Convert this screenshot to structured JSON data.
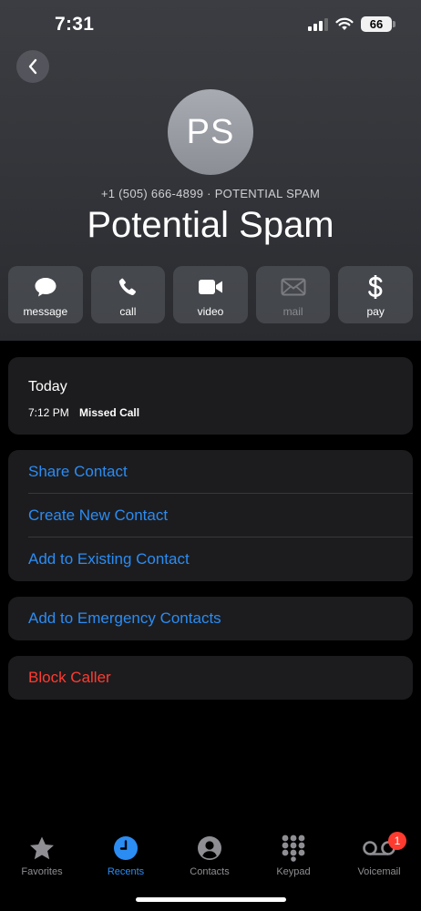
{
  "status_bar": {
    "time": "7:31",
    "battery": "66"
  },
  "contact": {
    "initials": "PS",
    "subtitle": "+1 (505) 666-4899 · POTENTIAL SPAM",
    "name": "Potential Spam"
  },
  "actions": [
    {
      "label": "message",
      "icon": "message-icon",
      "enabled": true
    },
    {
      "label": "call",
      "icon": "phone-icon",
      "enabled": true
    },
    {
      "label": "video",
      "icon": "video-icon",
      "enabled": true
    },
    {
      "label": "mail",
      "icon": "mail-icon",
      "enabled": false
    },
    {
      "label": "pay",
      "icon": "dollar-icon",
      "enabled": true
    }
  ],
  "history": {
    "title": "Today",
    "time": "7:12 PM",
    "kind": "Missed Call"
  },
  "contact_options": {
    "share": "Share Contact",
    "create": "Create New Contact",
    "add_existing": "Add to Existing Contact"
  },
  "emergency": "Add to Emergency Contacts",
  "block": "Block Caller",
  "tabs": [
    {
      "label": "Favorites",
      "icon": "star-icon",
      "active": false
    },
    {
      "label": "Recents",
      "icon": "clock-icon",
      "active": true
    },
    {
      "label": "Contacts",
      "icon": "person-icon",
      "active": false
    },
    {
      "label": "Keypad",
      "icon": "keypad-icon",
      "active": false
    },
    {
      "label": "Voicemail",
      "icon": "voicemail-icon",
      "active": false,
      "badge": "1"
    }
  ],
  "colors": {
    "accent": "#2b8cf3",
    "destructive": "#ff3b30",
    "card": "#1c1c1e"
  }
}
